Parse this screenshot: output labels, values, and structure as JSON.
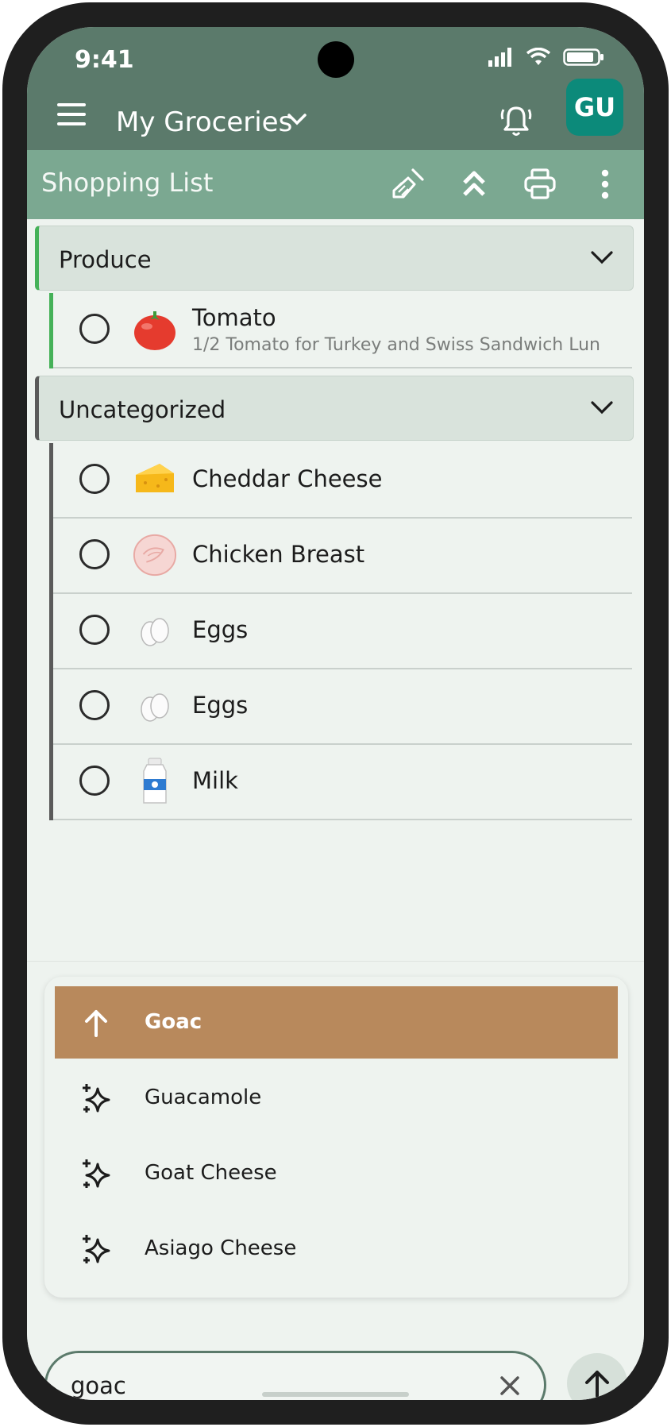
{
  "status": {
    "time": "9:41"
  },
  "header": {
    "title": "My Groceries",
    "avatar": "GU"
  },
  "subheader": {
    "title": "Shopping List"
  },
  "categories": [
    {
      "label": "Produce",
      "items": [
        {
          "name": "Tomato",
          "note": "1/2 Tomato for Turkey and Swiss Sandwich Lun",
          "icon": "tomato-icon"
        }
      ]
    },
    {
      "label": "Uncategorized",
      "items": [
        {
          "name": "Cheddar Cheese",
          "icon": "cheese-icon"
        },
        {
          "name": "Chicken Breast",
          "icon": "chicken-icon"
        },
        {
          "name": "Eggs",
          "icon": "eggs-icon"
        },
        {
          "name": "Eggs",
          "icon": "eggs-icon"
        },
        {
          "name": "Milk",
          "icon": "milk-icon"
        }
      ]
    }
  ],
  "suggestions": [
    {
      "label": "Goac",
      "icon": "arrow-up-icon",
      "active": true
    },
    {
      "label": "Guacamole",
      "icon": "sparkle-icon"
    },
    {
      "label": "Goat Cheese",
      "icon": "sparkle-icon"
    },
    {
      "label": "Asiago Cheese",
      "icon": "sparkle-icon"
    }
  ],
  "input": {
    "value": "goac"
  },
  "colors": {
    "appbar": "#5b7a6b",
    "subbar": "#7ba891",
    "active_suggestion": "#b8895c",
    "produce_accent": "#45b158",
    "avatar": "#0c8a7a"
  }
}
